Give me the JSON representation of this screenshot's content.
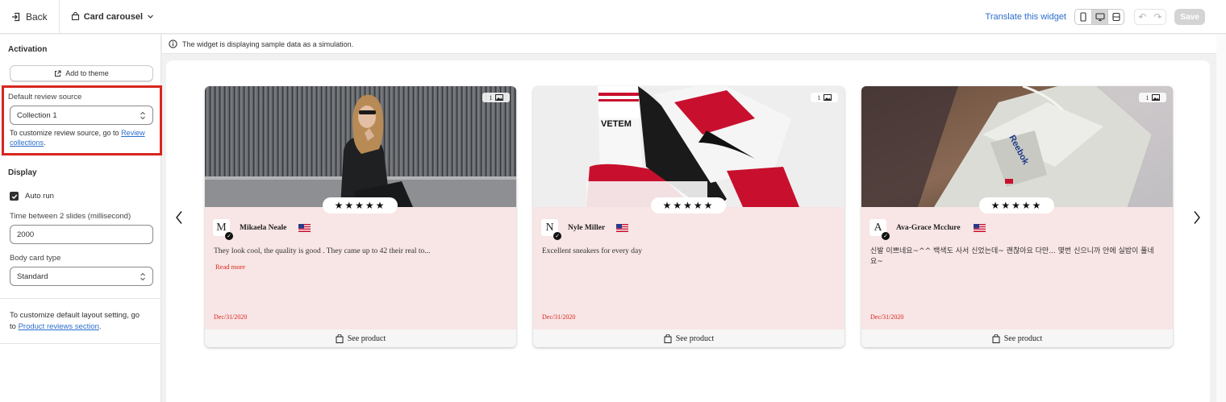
{
  "topbar": {
    "back_label": "Back",
    "widget_type": "Card carousel",
    "translate_label": "Translate this widget",
    "save_label": "Save"
  },
  "sidebar": {
    "activation": {
      "title": "Activation",
      "add_to_theme": "Add to theme"
    },
    "review_source": {
      "label": "Default review source",
      "value": "Collection 1",
      "note_prefix": "To customize review source, go to ",
      "link_part1": "Review",
      "link_part2": "collections",
      "note_suffix": "."
    },
    "display": {
      "title": "Display",
      "auto_run_label": "Auto run",
      "auto_run_checked": true,
      "time_label": "Time between 2 slides (millisecond)",
      "time_value": "2000",
      "body_type_label": "Body card type",
      "body_type_value": "Standard"
    },
    "layout_note": {
      "line1": "To customize default layout setting, go",
      "to_word": "to ",
      "link": "Product reviews section",
      "suffix": "."
    }
  },
  "info_bar": {
    "text": "The widget is displaying sample data as a simulation."
  },
  "carousel": {
    "cards": [
      {
        "photo_count": "1",
        "stars": "★★★★★",
        "avatar_letter": "M",
        "name": "Mikaela Neale",
        "text": "They look cool, the quality is good . They came up to 42 their real to...",
        "read_more": "Read more",
        "date": "Dec/31/2020",
        "see_product": "See product"
      },
      {
        "photo_count": "1",
        "stars": "★★★★★",
        "avatar_letter": "N",
        "name": "Nyle Miller",
        "text": "Excellent sneakers for every day",
        "date": "Dec/31/2020",
        "see_product": "See product",
        "sock_text": "VETEM"
      },
      {
        "photo_count": "1",
        "stars": "★★★★★",
        "avatar_letter": "A",
        "name": "Ava-Grace Mcclure",
        "text": "신발 이쁘네요~^^ 백색도 사서 신었는데~ 괜찮아요 다만... 몇번 신으니까 안에 실밥이 풀네요~",
        "date": "Dec/31/2020",
        "see_product": "See product",
        "shoe_brand": "Reebok"
      }
    ]
  },
  "colors": {
    "highlight_border": "#d7261e",
    "card_body": "#f8e5e5",
    "accent_red": "#d7261e",
    "link_blue": "#2c6ecb"
  }
}
